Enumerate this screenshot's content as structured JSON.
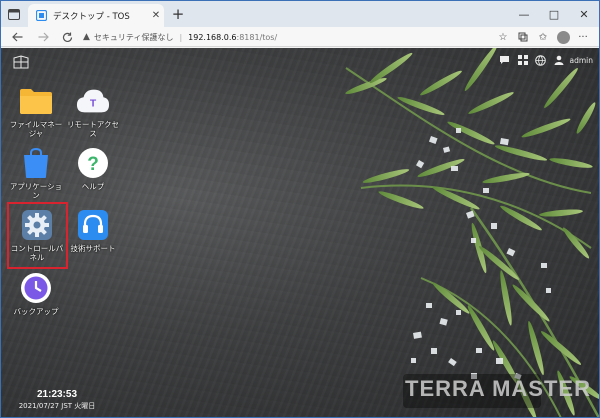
{
  "browser": {
    "tab_title": "デスクトップ - TOS",
    "tab_close": "✕",
    "new_tab": "+",
    "window_controls": [
      "—",
      "□",
      "✕"
    ],
    "security_label": "セキュリティ保護なし",
    "url_host": "192.168.0.6",
    "url_rest": ":8181/tos/",
    "icons": [
      "tab-overview-icon",
      "back-icon",
      "forward-icon",
      "reload-icon",
      "favorites-add-icon",
      "collections-icon",
      "favorites-icon",
      "profile-icon",
      "more-icon"
    ]
  },
  "tos": {
    "user_label": "admin",
    "toolbar_icons": [
      "chat-icon",
      "widgets-icon",
      "language-icon",
      "user-icon"
    ],
    "desktop_icons": [
      {
        "label": "ファイルマネージャ",
        "icon": "folder-icon"
      },
      {
        "label": "リモートアクセス",
        "icon": "cloud-icon"
      },
      {
        "label": "アプリケーション",
        "icon": "app-store-icon"
      },
      {
        "label": "ヘルプ",
        "icon": "help-icon"
      },
      {
        "label": "コントロールパネル",
        "icon": "gear-icon"
      },
      {
        "label": "技術サポート",
        "icon": "support-icon"
      },
      {
        "label": "バックアップ",
        "icon": "backup-icon"
      }
    ],
    "clock_time": "21:23:53",
    "clock_date": "2021/07/27 JST 火曜日",
    "brand": "TERRA MASTER",
    "highlight_color": "#d9232e",
    "accent_blue": "#2d8cf0"
  }
}
